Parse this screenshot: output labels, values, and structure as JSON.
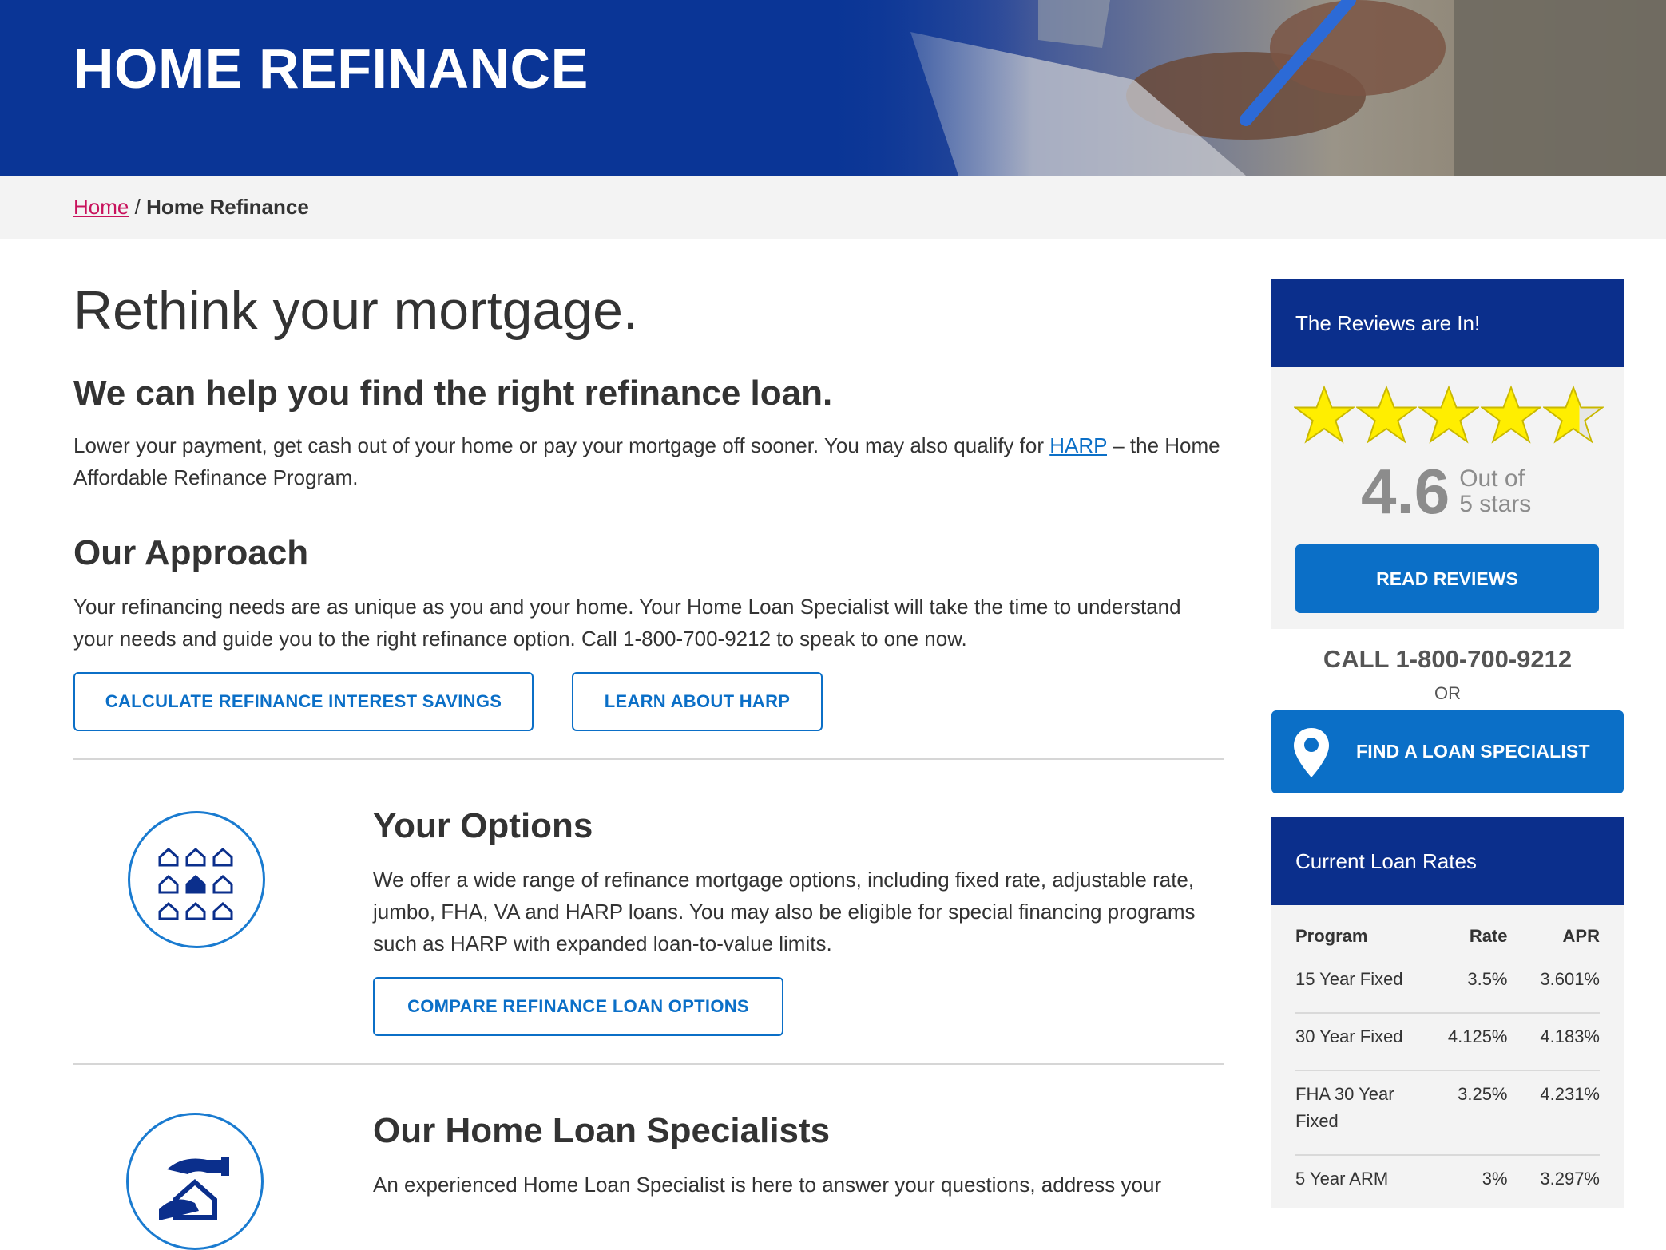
{
  "hero": {
    "title": "HOME REFINANCE"
  },
  "breadcrumb": {
    "home": "Home",
    "separator": "/",
    "current": "Home Refinance"
  },
  "main": {
    "headline": "Rethink your mortgage.",
    "subheadline": "We can help you find the right refinance loan.",
    "intro_text_before_link": "Lower your payment, get cash out of your home or pay your mortgage off sooner. You may also qualify for ",
    "intro_link": "HARP",
    "intro_text_after_link": " – the Home Affordable Refinance Program.",
    "approach": {
      "title": "Our Approach",
      "text": "Your refinancing needs are as unique as you and your home. Your Home Loan Specialist will take the time to understand your needs and guide you to the right refinance option. Call 1-800-700-9212 to speak to one now.",
      "button_calc": "CALCULATE REFINANCE INTEREST SAVINGS",
      "button_harp": "LEARN ABOUT HARP"
    },
    "options": {
      "title": "Your Options",
      "text": "We offer a wide range of refinance mortgage options, including fixed rate, adjustable rate, jumbo, FHA, VA and HARP loans. You may also be eligible for special financing programs such as HARP with expanded loan-to-value limits.",
      "button": "COMPARE REFINANCE LOAN OPTIONS",
      "icon": "houses-grid-icon"
    },
    "specialists": {
      "title": "Our Home Loan Specialists",
      "text": "An experienced Home Loan Specialist is here to answer your questions, address your",
      "icon": "hands-house-icon"
    }
  },
  "sidebar": {
    "reviews": {
      "title": "The Reviews are In!",
      "rating": 4.6,
      "score": "4.6",
      "out_of_line1": "Out of",
      "out_of_line2": "5 stars",
      "button": "READ REVIEWS"
    },
    "call": "CALL 1-800-700-9212",
    "or": "OR",
    "find_button": "FIND A LOAN SPECIALIST",
    "rates": {
      "title": "Current Loan Rates",
      "headers": [
        "Program",
        "Rate",
        "APR"
      ],
      "rows": [
        {
          "program": "15 Year Fixed",
          "rate": "3.5%",
          "apr": "3.601%"
        },
        {
          "program": "30 Year Fixed",
          "rate": "4.125%",
          "apr": "4.183%"
        },
        {
          "program": "FHA 30 Year Fixed",
          "rate": "3.25%",
          "apr": "4.231%"
        },
        {
          "program": "5 Year ARM",
          "rate": "3%",
          "apr": "3.297%"
        }
      ]
    }
  },
  "colors": {
    "brand_blue": "#0b2f8c",
    "accent_blue": "#0b6fc7",
    "link_pink": "#c8125c",
    "star_yellow": "#ffee00"
  }
}
